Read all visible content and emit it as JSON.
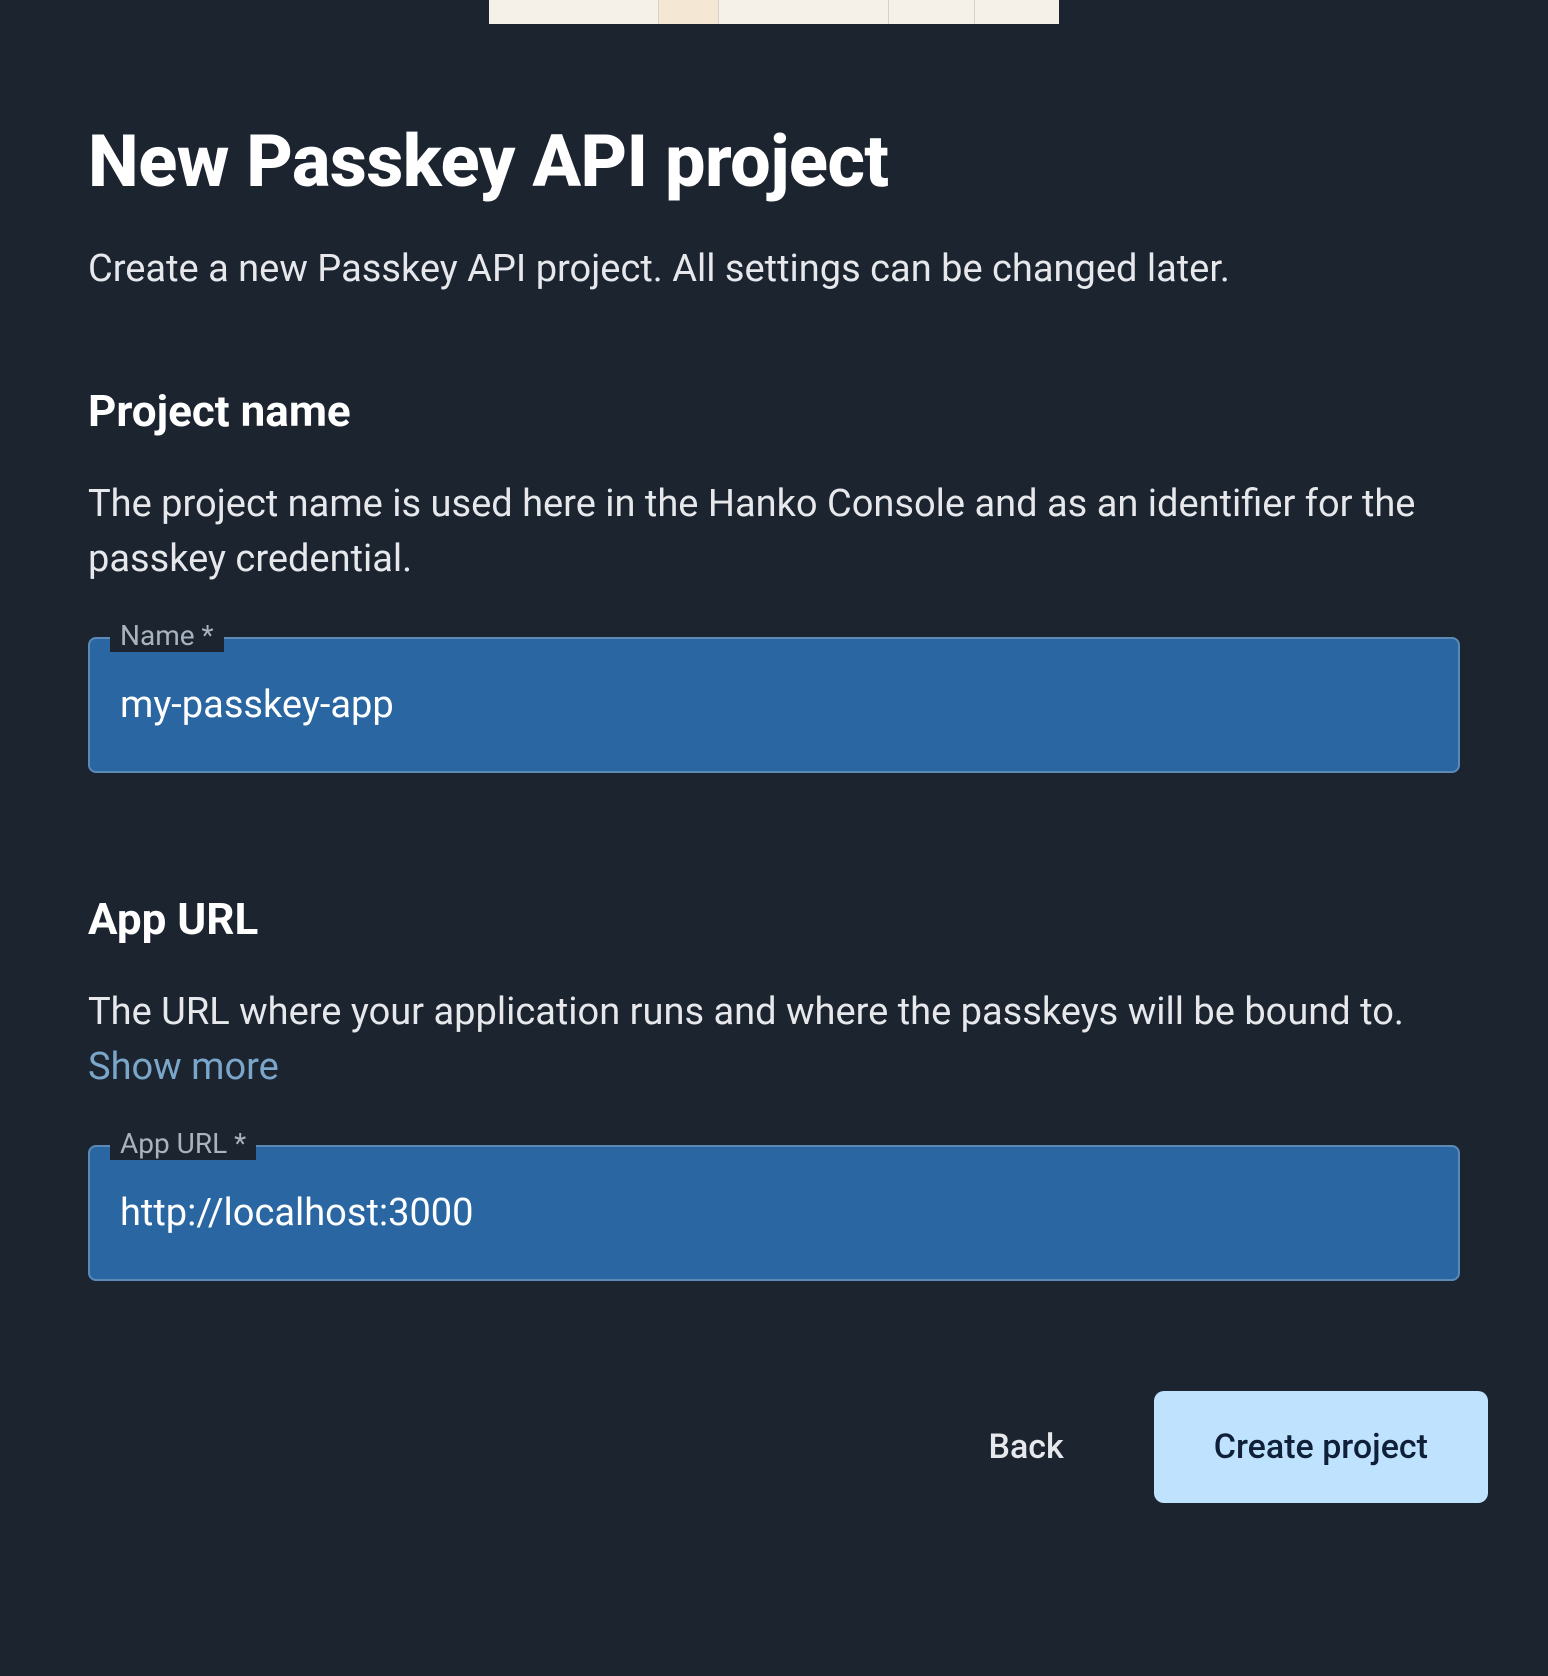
{
  "header": {
    "title": "New Passkey API project",
    "subtitle": "Create a new Passkey API project. All settings can be changed later."
  },
  "sections": {
    "projectName": {
      "heading": "Project name",
      "description": "The project name is used here in the Hanko Console and as an identifier for the passkey credential.",
      "field": {
        "label": "Name *",
        "value": "my-passkey-app"
      }
    },
    "appUrl": {
      "heading": "App URL",
      "descriptionPrefix": "The URL where your application runs and where the passkeys will be bound to. ",
      "showMore": "Show more",
      "field": {
        "label": "App URL *",
        "value": "http://localhost:3000"
      }
    }
  },
  "footer": {
    "back": "Back",
    "create": "Create project"
  }
}
